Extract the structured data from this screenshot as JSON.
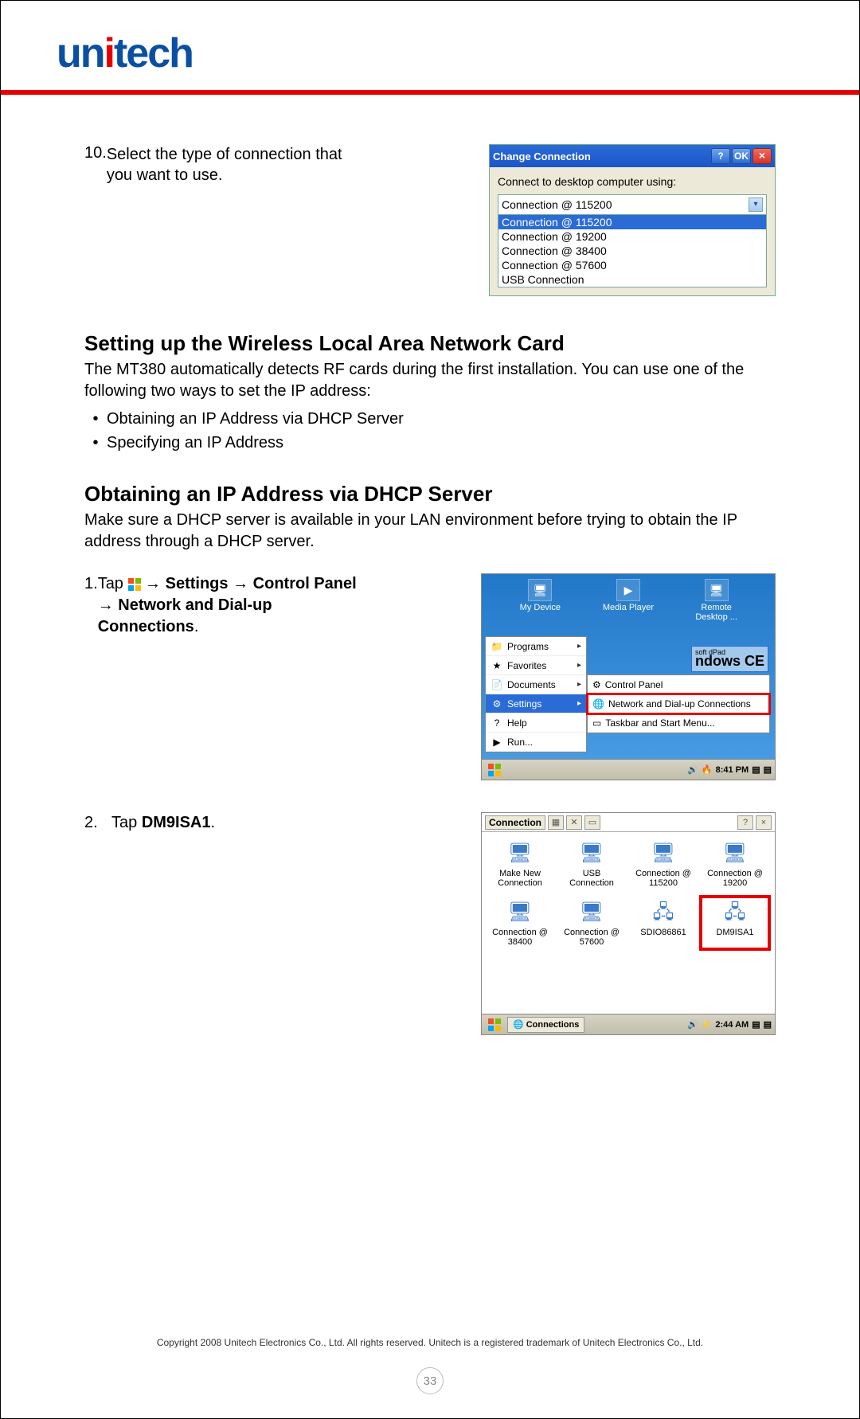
{
  "logo_text_pre": "un",
  "logo_dot": "i",
  "logo_text_post": "tech",
  "step10": {
    "num": "10.",
    "text": "Select the type of connection that you want to use."
  },
  "dialog1": {
    "title": "Change Connection",
    "help": "?",
    "ok": "OK",
    "close": "×",
    "label": "Connect to desktop computer using:",
    "selected": "Connection @ 115200",
    "options": [
      "Connection @ 115200",
      "Connection @ 19200",
      "Connection @ 38400",
      "Connection @ 57600",
      "USB Connection"
    ]
  },
  "sec1": {
    "title": "Setting up the Wireless Local Area Network Card",
    "para": "The MT380 automatically detects RF cards during the first installation. You can use one of the following two ways to set the IP address:",
    "b1": "Obtaining an IP Address via DHCP Server",
    "b2": "Specifying an IP Address"
  },
  "sec2": {
    "title": "Obtaining an IP Address via DHCP Server",
    "para": "Make sure a DHCP server is available in your LAN environment before trying to obtain the IP address through a DHCP server."
  },
  "step1": {
    "num": "1.",
    "pre": "Tap ",
    "b1": "Settings",
    "b2": "Control Panel",
    "b3": "Network and Dial-up Connections",
    "arrow": " → "
  },
  "shot2": {
    "desk": [
      {
        "label": "My Device",
        "ic": "🖥"
      },
      {
        "label": "Media Player",
        "ic": "▶"
      },
      {
        "label": "Remote Desktop ...",
        "ic": "🖥"
      }
    ],
    "start": [
      {
        "label": "Programs",
        "ic": "📁",
        "arr": "▸"
      },
      {
        "label": "Favorites",
        "ic": "★",
        "arr": "▸"
      },
      {
        "label": "Documents",
        "ic": "📄",
        "arr": "▸"
      },
      {
        "label": "Settings",
        "ic": "⚙",
        "arr": "▸",
        "sel": true
      },
      {
        "label": "Help",
        "ic": "?",
        "arr": ""
      },
      {
        "label": "Run...",
        "ic": "▶",
        "arr": ""
      }
    ],
    "sub": [
      {
        "label": "Control Panel",
        "ic": "⚙"
      },
      {
        "label": "Network and Dial-up Connections",
        "ic": "🌐",
        "hl": true
      },
      {
        "label": "Taskbar and Start Menu...",
        "ic": "▭"
      }
    ],
    "ce_soft": "soft\ndPad",
    "ce": "ndows CE",
    "time": "8:41 PM"
  },
  "step2": {
    "num": "2.",
    "pre": "Tap ",
    "bold": "DM9ISA1",
    "post": "."
  },
  "shot3": {
    "title": "Connection",
    "row1": [
      {
        "label": "Make New Connection",
        "ic": "🖥"
      },
      {
        "label": "USB Connection",
        "ic": "🖥"
      },
      {
        "label": "Connection @ 115200",
        "ic": "🖥"
      },
      {
        "label": "Connection @ 19200",
        "ic": "🖥"
      }
    ],
    "row2": [
      {
        "label": "Connection @ 38400",
        "ic": "🖥"
      },
      {
        "label": "Connection @ 57600",
        "ic": "🖥"
      },
      {
        "label": "SDIO86861",
        "ic": "🖧"
      },
      {
        "label": "DM9ISA1",
        "ic": "🖧",
        "hl": true
      }
    ],
    "taskbtn": "Connections",
    "time": "2:44 AM"
  },
  "footer": "Copyright 2008 Unitech Electronics Co., Ltd. All rights reserved. Unitech is a registered trademark of Unitech Electronics Co., Ltd.",
  "pagenum": "33"
}
